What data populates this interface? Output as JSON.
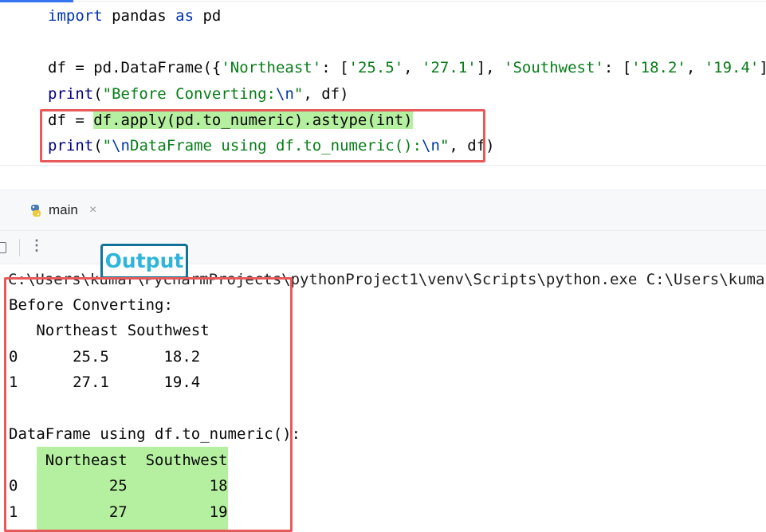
{
  "editor": {
    "lines": {
      "l1": {
        "kw1": "import",
        "mid": " pandas ",
        "kw2": "as",
        "end": " pd"
      },
      "l3": {
        "a": "df = pd.DataFrame({",
        "s1": "'Northeast'",
        "b": ": [",
        "s2": "'25.5'",
        "c": ", ",
        "s3": "'27.1'",
        "d": "], ",
        "s4": "'Southwest'",
        "e": ": [",
        "s5": "'18.2'",
        "f": ", ",
        "s6": "'19.4'",
        "g": "]})"
      },
      "l4": {
        "fn": "print",
        "p1": "(",
        "s": "\"Before Converting:",
        "esc": "\\n",
        "q": "\"",
        "rest": ", df)"
      },
      "l5": {
        "a": "df = ",
        "hl": "df.apply(pd.to_numeric).astype(int)"
      },
      "l6": {
        "fn": "print",
        "p1": "(",
        "s1": "\"",
        "esc1": "\\n",
        "s2": "DataFrame using df.to_numeric():",
        "esc2": "\\n",
        "q": "\"",
        "rest": ", df)"
      }
    }
  },
  "run_tab": {
    "label": "main",
    "close": "×"
  },
  "toolbar": {
    "more": "⋮"
  },
  "badge": {
    "label": "Output"
  },
  "console": {
    "command": "C:\\Users\\kumar\\PycharmProjects\\pythonProject1\\venv\\Scripts\\python.exe C:\\Users\\kumar\\Py",
    "before_title": "Before Converting:",
    "before_header": "   Northeast Southwest",
    "before_rows": [
      "0      25.5      18.2",
      "1      27.1      19.4"
    ],
    "after_title": "DataFrame using df.to_numeric():",
    "after_header": "    Northeast  Southwest",
    "after_rows": [
      "0          25         18",
      "1          27         19"
    ]
  },
  "colors": {
    "highlight_red": "#e85a5a",
    "highlight_green": "#b5f0a0",
    "badge_border": "#11739a",
    "badge_text": "#2fb5dc"
  }
}
